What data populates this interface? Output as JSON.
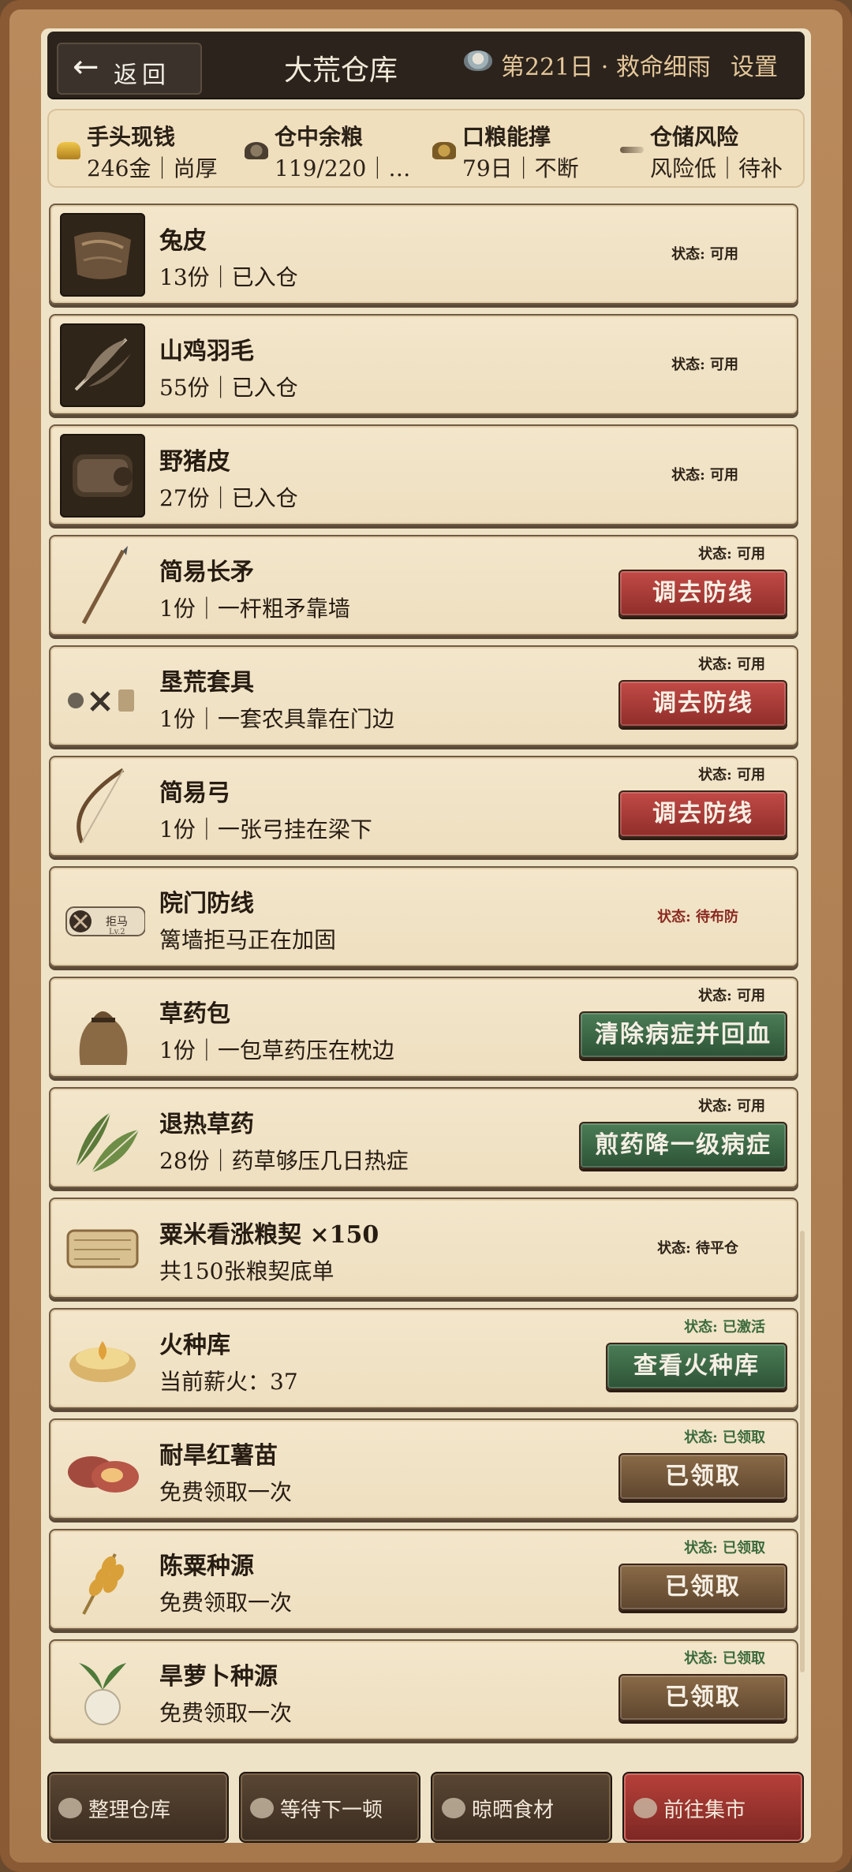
{
  "header": {
    "back_label": "返回",
    "title": "大荒仓库",
    "day_text": "第221日 · 救命细雨",
    "settings_label": "设置"
  },
  "stats": [
    {
      "name": "手头现钱",
      "value": "246金｜尚厚",
      "icon": "gold-ingot-icon"
    },
    {
      "name": "仓中余粮",
      "value": "119/220｜…",
      "icon": "grain-pile-icon"
    },
    {
      "name": "口粮能撑",
      "value": "79日｜不断",
      "icon": "grain-sack-icon"
    },
    {
      "name": "仓储风险",
      "value": "风险低｜待补",
      "icon": "brush-icon"
    }
  ],
  "items": [
    {
      "title": "兔皮",
      "sub": "13份｜已入仓",
      "status": "状态: 可用",
      "action": null,
      "icon": "rabbit-pelt-icon"
    },
    {
      "title": "山鸡羽毛",
      "sub": "55份｜已入仓",
      "status": "状态: 可用",
      "action": null,
      "icon": "feather-icon"
    },
    {
      "title": "野猪皮",
      "sub": "27份｜已入仓",
      "status": "状态: 可用",
      "action": null,
      "icon": "boar-hide-icon"
    },
    {
      "title": "简易长矛",
      "sub": "1份｜一杆粗矛靠墙",
      "status": "状态: 可用",
      "action": "调去防线",
      "icon": "spear-icon"
    },
    {
      "title": "垦荒套具",
      "sub": "1份｜一套农具靠在门边",
      "status": "状态: 可用",
      "action": "调去防线",
      "icon": "farm-tools-icon"
    },
    {
      "title": "简易弓",
      "sub": "1份｜一张弓挂在梁下",
      "status": "状态: 可用",
      "action": "调去防线",
      "icon": "bow-icon"
    },
    {
      "title": "院门防线",
      "sub": "篱墙拒马正在加固",
      "status": "状态: 待布防",
      "action": null,
      "icon": "barricade-icon",
      "badge": "拒马",
      "badge_sub": "Lv.2"
    },
    {
      "title": "草药包",
      "sub": "1份｜一包草药压在枕边",
      "status": "状态: 可用",
      "action": "清除病症并回血",
      "icon": "herb-bag-icon"
    },
    {
      "title": "退热草药",
      "sub": "28份｜药草够压几日热症",
      "status": "状态: 可用",
      "action": "煎药降一级病症",
      "icon": "herb-leaves-icon"
    },
    {
      "title": "粟米看涨粮契 ×150",
      "sub": "共150张粮契底单",
      "status": "状态: 待平仓",
      "action": null,
      "icon": "scroll-icon"
    },
    {
      "title": "火种库",
      "sub": "当前薪火：37",
      "status": "状态: 已激活",
      "action": "查看火种库",
      "icon": "fire-bowl-icon"
    },
    {
      "title": "耐旱红薯苗",
      "sub": "免费领取一次",
      "status": "状态: 已领取",
      "action": "已领取",
      "icon": "sweet-potato-icon"
    },
    {
      "title": "陈粟种源",
      "sub": "免费领取一次",
      "status": "状态: 已领取",
      "action": "已领取",
      "icon": "millet-icon"
    },
    {
      "title": "旱萝卜种源",
      "sub": "免费领取一次",
      "status": "状态: 已领取",
      "action": "已领取",
      "icon": "radish-icon"
    }
  ],
  "footer": [
    {
      "label": "整理仓库",
      "icon": "organize-icon"
    },
    {
      "label": "等待下一顿",
      "icon": "rice-bowl-icon"
    },
    {
      "label": "晾晒食材",
      "icon": "drying-rack-icon"
    },
    {
      "label": "前往集市",
      "icon": "market-icon"
    }
  ],
  "colors": {
    "action_red": "#a8382f",
    "action_green": "#3b6a45",
    "action_brown": "#76583a",
    "status_red": "#8a2a22",
    "status_green": "#3b6a3c"
  }
}
